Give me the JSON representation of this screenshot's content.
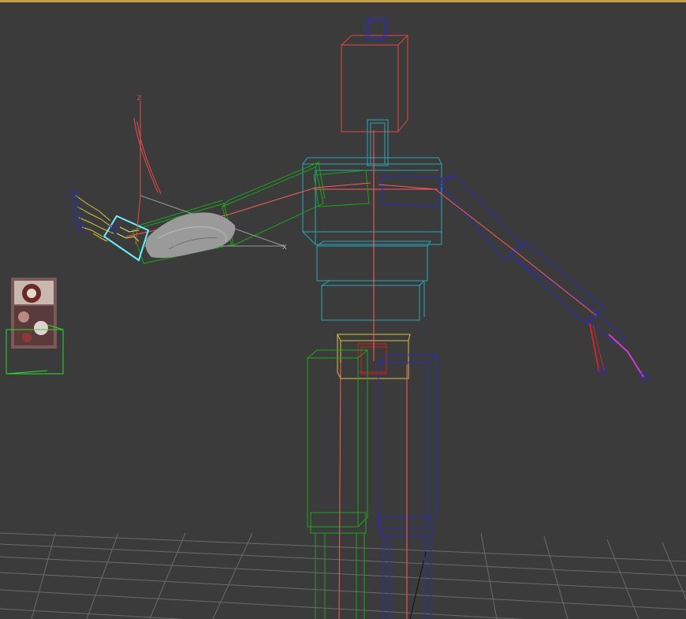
{
  "viewport": {
    "name": "3d-perspective-viewport",
    "axis_labels": {
      "x": "X",
      "z": "Z"
    }
  },
  "colors": {
    "background": "#3b3b3b",
    "frame_highlight": "#c8a24a",
    "grid": "#6a6a6a",
    "spine_bones": "#ff5b5b",
    "torso_boxes": "#2aa6b8",
    "left_limb_boxes": "#1ea41e",
    "right_limb_boxes": "#2b2bc8",
    "head_box": "#e04848",
    "pelvis_box": "#e0c040",
    "selected_outline": "#6ef0ff",
    "finger_bones": "#d6c93a",
    "gizmo_axis": "#e84a4a",
    "helper_box": "#2fd82f",
    "right_hand_bone_red": "#c42a2a",
    "right_hand_bone_magenta": "#d23ad2"
  },
  "objects": [
    "head-bone-box",
    "neck-bone-box",
    "spine-chest-box",
    "spine-abdomen-box",
    "pelvis-box",
    "left-upper-arm-box",
    "left-forearm-box",
    "left-hand-box-selected",
    "left-hand-mesh",
    "right-upper-arm-box",
    "right-forearm-box",
    "right-hand-bones",
    "left-thigh-box",
    "right-thigh-box",
    "texture-helper-object",
    "transform-gizmo"
  ]
}
